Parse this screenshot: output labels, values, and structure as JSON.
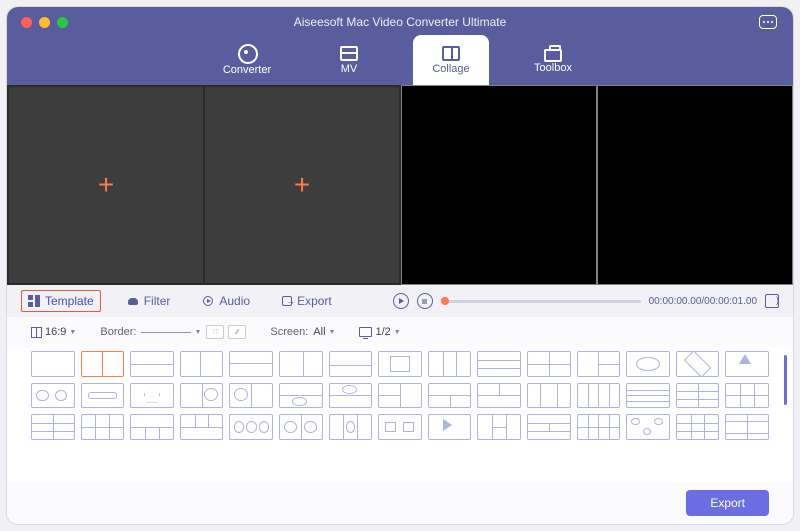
{
  "app": {
    "title": "Aiseesoft Mac Video Converter Ultimate"
  },
  "nav": {
    "items": [
      {
        "label": "Converter"
      },
      {
        "label": "MV"
      },
      {
        "label": "Collage"
      },
      {
        "label": "Toolbox"
      }
    ],
    "active": 2
  },
  "subtabs": {
    "items": [
      {
        "label": "Template"
      },
      {
        "label": "Filter"
      },
      {
        "label": "Audio"
      },
      {
        "label": "Export"
      }
    ],
    "active": 0
  },
  "player": {
    "time_current": "00:00:00.00",
    "time_total": "00:00:01.00"
  },
  "options": {
    "ratio": "16:9",
    "border_label": "Border:",
    "screen_label": "Screen:",
    "screen_value": "All",
    "split_value": "1/2"
  },
  "footer": {
    "export_label": "Export"
  },
  "colors": {
    "primary": "#5a5d9d",
    "accent": "#ff7a4a",
    "button": "#6b6de0"
  }
}
